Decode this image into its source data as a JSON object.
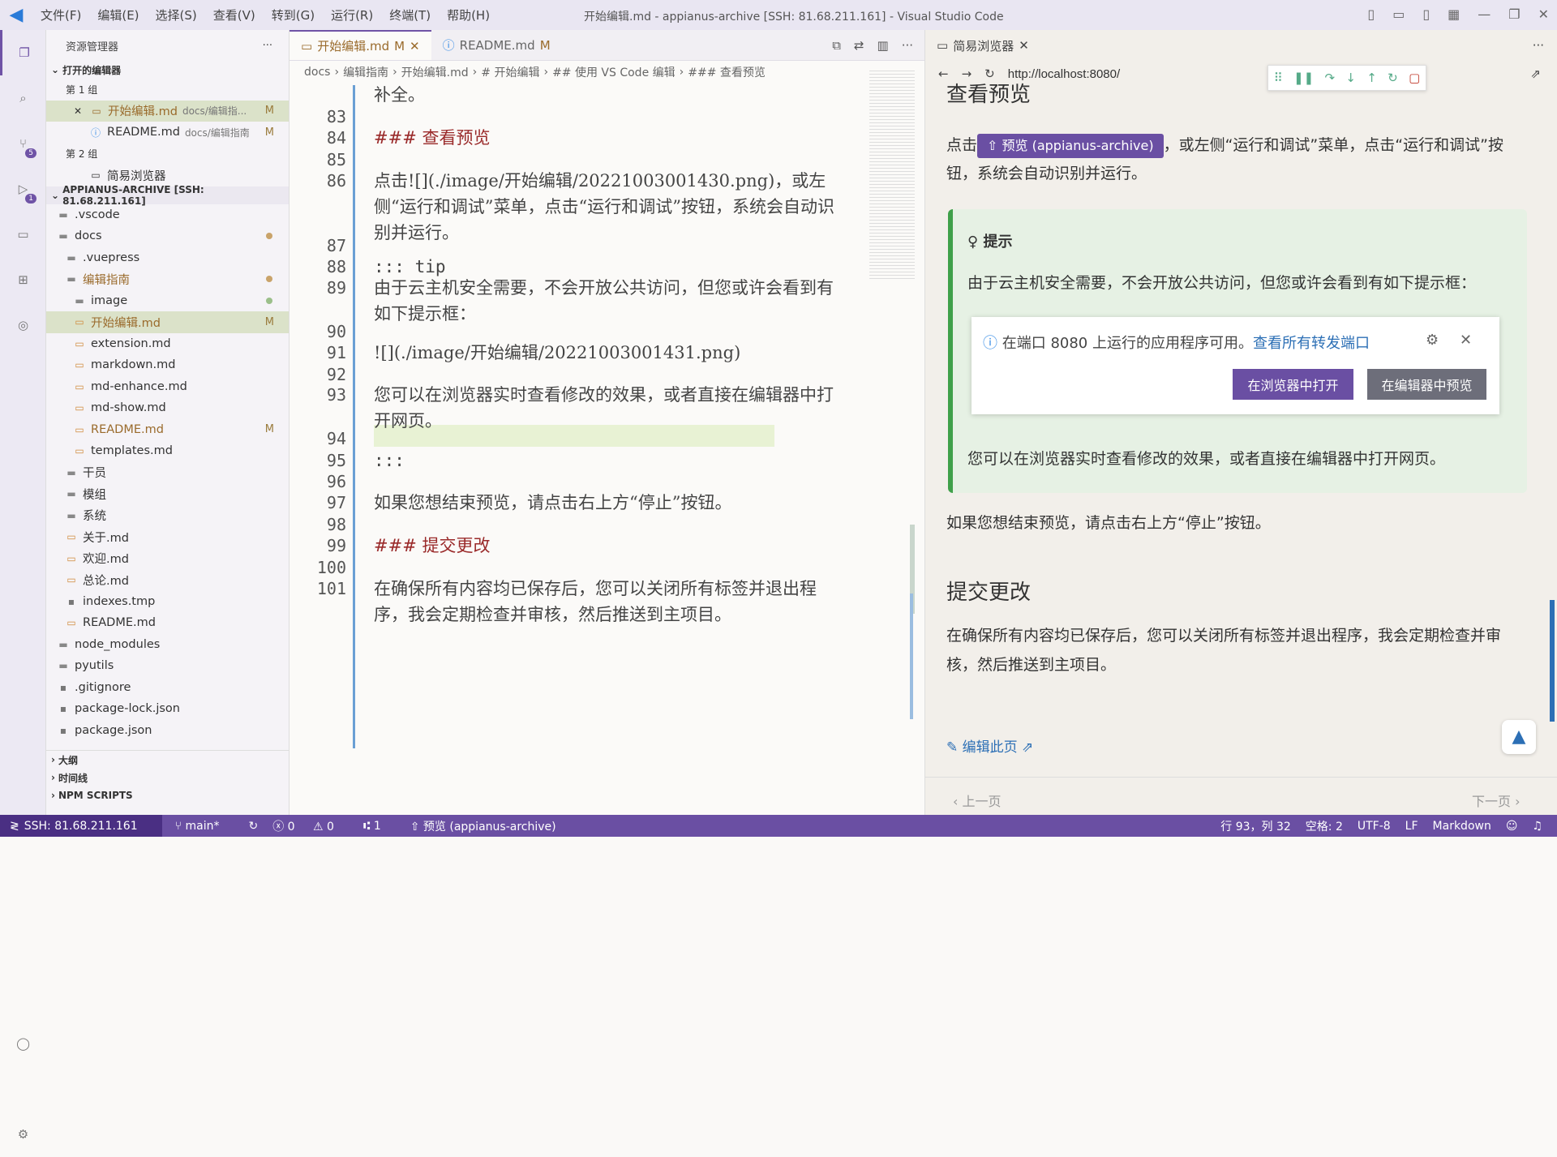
{
  "titlebar": {
    "menus": [
      "文件(F)",
      "编辑(E)",
      "选择(S)",
      "查看(V)",
      "转到(G)",
      "运行(R)",
      "终端(T)",
      "帮助(H)"
    ],
    "title": "开始编辑.md - appianus-archive [SSH: 81.68.211.161] - Visual Studio Code"
  },
  "sidebar": {
    "header": "资源管理器",
    "open_editors": "打开的编辑器",
    "group1": "第 1 组",
    "group2": "第 2 组",
    "open_items": [
      {
        "label": "开始编辑.md",
        "path": "docs/编辑指...",
        "mark": "M"
      },
      {
        "label": "README.md",
        "path": "docs/编辑指南",
        "mark": "M"
      },
      {
        "label": "简易浏览器",
        "path": "",
        "mark": ""
      }
    ],
    "root": "APPIANUS-ARCHIVE [SSH: 81.68.211.161]",
    "tree": [
      ".vscode",
      "docs",
      ".vuepress",
      "编辑指南",
      "image",
      "开始编辑.md",
      "extension.md",
      "markdown.md",
      "md-enhance.md",
      "md-show.md",
      "README.md",
      "templates.md",
      "干员",
      "模组",
      "系统",
      "关于.md",
      "欢迎.md",
      "总论.md",
      "indexes.tmp",
      "README.md",
      "node_modules",
      "pyutils",
      ".gitignore",
      "package-lock.json",
      "package.json"
    ],
    "tree_marks": {
      "kaishi": "M",
      "readme": "M"
    },
    "bottom": [
      "大纲",
      "时间线",
      "NPM SCRIPTS"
    ],
    "badges": {
      "scm": "5",
      "debug": "1"
    }
  },
  "editor": {
    "tabs": [
      {
        "label": "开始编辑.md",
        "mark": "M"
      },
      {
        "label": "README.md",
        "mark": "M"
      }
    ],
    "crumbs": [
      "docs",
      "编辑指南",
      "开始编辑.md",
      "# 开始编辑",
      "## 使用 VS Code 编辑",
      "### 查看预览"
    ],
    "lines": [
      {
        "n": "",
        "t": "补全。"
      },
      {
        "n": "83",
        "t": ""
      },
      {
        "n": "84",
        "t": "### 查看预览"
      },
      {
        "n": "85",
        "t": ""
      },
      {
        "n": "86",
        "t": "点击![](./image/开始编辑/20221003001430.png)，或左侧“运行和调试”菜单，点击“运行和调试”按钮，系统会自动识别并运行。"
      },
      {
        "n": "87",
        "t": ""
      },
      {
        "n": "88",
        "t": "::: tip"
      },
      {
        "n": "89",
        "t": "由于云主机安全需要，不会开放公共访问，但您或许会看到有如下提示框："
      },
      {
        "n": "90",
        "t": ""
      },
      {
        "n": "91",
        "t": "![](./image/开始编辑/20221003001431.png)"
      },
      {
        "n": "92",
        "t": ""
      },
      {
        "n": "93",
        "t": "您可以在浏览器实时查看修改的效果，或者直接在编辑器中打开网页。"
      },
      {
        "n": "94",
        "t": ""
      },
      {
        "n": "95",
        "t": ":::"
      },
      {
        "n": "96",
        "t": ""
      },
      {
        "n": "97",
        "t": "如果您想结束预览，请点击右上方“停止”按钮。"
      },
      {
        "n": "98",
        "t": ""
      },
      {
        "n": "99",
        "t": "### 提交更改"
      },
      {
        "n": "100",
        "t": ""
      },
      {
        "n": "101",
        "t": "在确保所有内容均已保存后，您可以关闭所有标签并退出程序，我会定期检查并审核，然后推送到主项目。"
      }
    ]
  },
  "browser": {
    "tab": "简易浏览器",
    "url": "http://localhost:8080/",
    "h_preview": "查看预览",
    "p1_before": "点击",
    "p1_pill": "预览 (appianus-archive)",
    "p1_after": "，或左侧“运行和调试”菜单，点击“运行和调试”按钮，系统会自动识别并运行。",
    "tip_title": "提示",
    "tip_text": "由于云主机安全需要，不会开放公共访问，但您或许会看到有如下提示框：",
    "notif_text": "在端口 8080 上运行的应用程序可用。",
    "notif_link": "查看所有转发端口",
    "btn_open": "在浏览器中打开",
    "btn_preview": "在编辑器中预览",
    "tip_end": "您可以在浏览器实时查看修改的效果，或者直接在编辑器中打开网页。",
    "p_stop": "如果您想结束预览，请点击右上方“停止”按钮。",
    "h_commit": "提交更改",
    "p_commit": "在确保所有内容均已保存后，您可以关闭所有标签并退出程序，我会定期检查并审核，然后推送到主项目。",
    "edit": "编辑此页",
    "prev": "‹ 上一页",
    "next": "下一页 ›"
  },
  "status": {
    "remote": "SSH: 81.68.211.161",
    "branch": "main*",
    "problems": "0",
    "warnings": "0",
    "ports": "1",
    "run": "预览 (appianus-archive)",
    "cursor": "行 93，列 32",
    "spaces": "空格: 2",
    "encoding": "UTF-8",
    "eol": "LF",
    "lang": "Markdown"
  },
  "colors": {
    "accent": "#6a4fa3",
    "tip": "#3fa04a"
  }
}
